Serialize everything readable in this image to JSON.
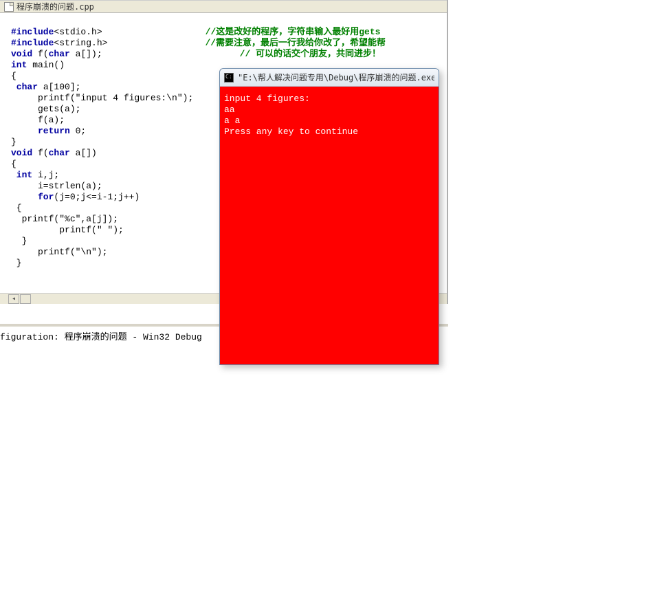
{
  "editor": {
    "tab_filename": "程序崩溃的问题.cpp",
    "code": {
      "l1a": "#include",
      "l1b": "<stdio.h>",
      "comment1": "//这是改好的程序，字符串输入最好用gets",
      "l2a": "#include",
      "l2b": "<string.h>",
      "comment2": "//需要注意，最后一行我给你改了，希望能帮",
      "l3a": "void",
      "l3b": " f(",
      "l3c": "char",
      "l3d": " a[]);",
      "comment3": "// 可以的话交个朋友，共同进步！",
      "l4a": "int",
      "l4b": " main()",
      "l5": "{",
      "l6a": " char",
      "l6b": " a[100];",
      "l7": "     printf(\"input 4 figures:\\n\");",
      "l8": "     gets(a);",
      "l9": "     f(a);",
      "l10a": "     return",
      "l10b": " 0;",
      "l11": "}",
      "l12a": "void",
      "l12b": " f(",
      "l12c": "char",
      "l12d": " a[])",
      "l13": "{",
      "l14a": " int",
      "l14b": " i,j;",
      "l15": "     i=strlen(a);",
      "l16a": "     for",
      "l16b": "(j=0;j<=i-1;j++)",
      "l17": " {",
      "l18": "  printf(\"%c\",a[j]);",
      "l19": "         printf(\" \");",
      "l20": "  }",
      "l21": "     printf(\"\\n\");",
      "l22": " }"
    }
  },
  "output": {
    "line": "figuration: 程序崩溃的问题 - Win32 Debug"
  },
  "console": {
    "title": "\"E:\\帮人解决问题专用\\Debug\\程序崩溃的问题.exe\"",
    "lines": [
      "input 4 figures:",
      "aa",
      "a a",
      "Press any key to continue"
    ]
  }
}
